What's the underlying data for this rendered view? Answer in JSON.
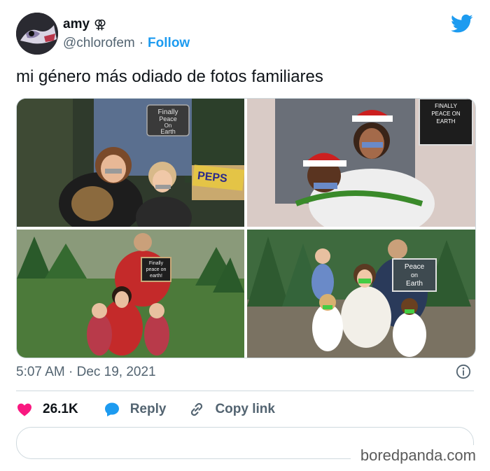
{
  "author": {
    "name": "amy",
    "symbol": "⚢",
    "handle": "@chlorofem",
    "separator": "·",
    "follow_label": "Follow"
  },
  "tweet": {
    "text": "mi género más odiado de fotos familiares",
    "timestamp": "5:07 AM · Dec 19, 2021"
  },
  "photos": [
    {
      "sign": [
        "Finally",
        "Peace",
        "On",
        "Earth"
      ],
      "banner": "PEPS"
    },
    {
      "sign": [
        "FINALLY",
        "PEACE ON",
        "EARTH"
      ]
    },
    {
      "sign": [
        "Finally",
        "peace on",
        "earth!"
      ]
    },
    {
      "sign": [
        "Peace",
        "on",
        "Earth"
      ]
    }
  ],
  "actions": {
    "likes": "26.1K",
    "reply_label": "Reply",
    "copy_label": "Copy link"
  },
  "watermark": "boredpanda.com",
  "colors": {
    "accent": "#1d9bf0",
    "heart": "#f91880",
    "muted": "#536471"
  },
  "icons": [
    "twitter-bird-icon",
    "info-icon",
    "heart-icon",
    "reply-bubble-icon",
    "link-icon"
  ]
}
